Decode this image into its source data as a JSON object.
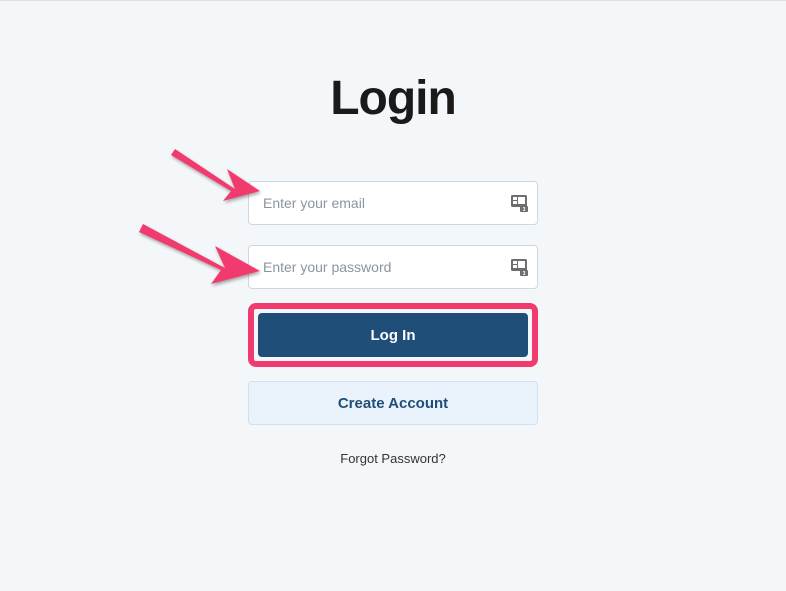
{
  "title": "Login",
  "fields": {
    "email": {
      "placeholder": "Enter your email",
      "value": ""
    },
    "password": {
      "placeholder": "Enter your password",
      "value": ""
    }
  },
  "buttons": {
    "login": "Log In",
    "create": "Create Account"
  },
  "links": {
    "forgot": "Forgot Password?"
  },
  "colors": {
    "accent": "#1f4e79",
    "highlight": "#f13b6e",
    "page_bg": "#f4f7fa"
  },
  "icons": {
    "autofill": "autofill-icon"
  }
}
